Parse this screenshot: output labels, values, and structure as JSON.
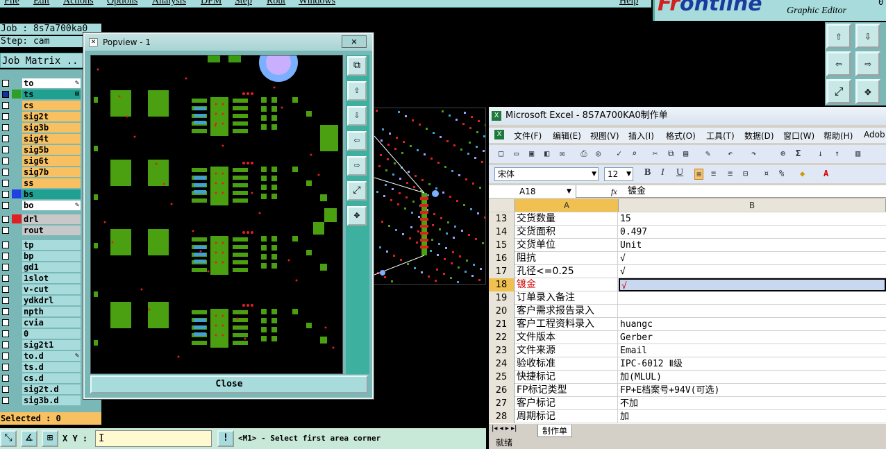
{
  "menu": [
    "File",
    "Edit",
    "Actions",
    "Options",
    "Analysis",
    "DFM",
    "Step",
    "Rout",
    "Windows",
    "Help"
  ],
  "logo": {
    "brand_a": "Fr",
    "brand_b": "ontline",
    "subtitle": "Graphic Editor",
    "version_tail": "0"
  },
  "job": {
    "job_label": "Job : 8s7a700ka0",
    "step_label": "Step: cam",
    "matrix_button": "Job Matrix .."
  },
  "layers": [
    {
      "name": "to",
      "bg": "#ffffff",
      "color": "",
      "icon": "pen"
    },
    {
      "name": "ts",
      "bg": "#20a090",
      "color": "#2aa02a",
      "icon": "grid",
      "checked": true
    },
    {
      "name": "cs",
      "bg": "#f8c060",
      "color": ""
    },
    {
      "name": "sig2t",
      "bg": "#f8c060",
      "color": ""
    },
    {
      "name": "sig3b",
      "bg": "#f8c060",
      "color": ""
    },
    {
      "name": "sig4t",
      "bg": "#f8c060",
      "color": ""
    },
    {
      "name": "sig5b",
      "bg": "#f8c060",
      "color": ""
    },
    {
      "name": "sig6t",
      "bg": "#f8c060",
      "color": ""
    },
    {
      "name": "sig7b",
      "bg": "#f8c060",
      "color": ""
    },
    {
      "name": "ss",
      "bg": "#f8c060",
      "color": ""
    },
    {
      "name": "bs",
      "bg": "#20a090",
      "color": "#2040e0"
    },
    {
      "name": "bo",
      "bg": "#ffffff",
      "color": "",
      "icon": "pen"
    },
    {
      "name": "drl",
      "bg": "#c8c8c8",
      "color": "#e02020"
    },
    {
      "name": "rout",
      "bg": "#c8c8c8",
      "color": ""
    },
    {
      "name": "tp",
      "bg": "#a8dcdc",
      "color": ""
    },
    {
      "name": "bp",
      "bg": "#a8dcdc",
      "color": ""
    },
    {
      "name": "gd1",
      "bg": "#a8dcdc",
      "color": ""
    },
    {
      "name": "1slot",
      "bg": "#a8dcdc",
      "color": ""
    },
    {
      "name": "v-cut",
      "bg": "#a8dcdc",
      "color": ""
    },
    {
      "name": "ydkdrl",
      "bg": "#a8dcdc",
      "color": ""
    },
    {
      "name": "npth",
      "bg": "#a8dcdc",
      "color": ""
    },
    {
      "name": "cvia",
      "bg": "#a8dcdc",
      "color": ""
    },
    {
      "name": "0",
      "bg": "#a8dcdc",
      "color": ""
    },
    {
      "name": "sig2t1",
      "bg": "#a8dcdc",
      "color": ""
    },
    {
      "name": "to.d",
      "bg": "#a8dcdc",
      "color": "",
      "icon": "pen"
    },
    {
      "name": "ts.d",
      "bg": "#a8dcdc",
      "color": ""
    },
    {
      "name": "cs.d",
      "bg": "#a8dcdc",
      "color": ""
    },
    {
      "name": "sig2t.d",
      "bg": "#a8dcdc",
      "color": ""
    },
    {
      "name": "sig3b.d",
      "bg": "#a8dcdc",
      "color": ""
    }
  ],
  "selected_label": "Selected : 0",
  "bottom": {
    "xy_label": "X Y :",
    "status_message": "<M1> - Select first area corner"
  },
  "popview": {
    "title": "Popview - 1",
    "close_x": "✕",
    "close_button": "Close"
  },
  "excel": {
    "title": "Microsoft Excel - 8S7A700KA0制作单",
    "menu": [
      "文件(F)",
      "编辑(E)",
      "视图(V)",
      "插入(I)",
      "格式(O)",
      "工具(T)",
      "数据(D)",
      "窗口(W)",
      "帮助(H)",
      "Adob"
    ],
    "font_name": "宋体",
    "font_size": "12",
    "cell_ref": "A18",
    "formula_value": "镀金",
    "col_a": "A",
    "col_b": "B",
    "rows": [
      {
        "n": "13",
        "a": "交货数量",
        "b": "15"
      },
      {
        "n": "14",
        "a": "交货面积",
        "b": "0.497"
      },
      {
        "n": "15",
        "a": "交货单位",
        "b": "Unit"
      },
      {
        "n": "16",
        "a": "阻抗",
        "b": "√"
      },
      {
        "n": "17",
        "a": "孔径<=0.25",
        "b": "√"
      },
      {
        "n": "18",
        "a": "镀金",
        "b": "√",
        "sel": true
      },
      {
        "n": "19",
        "a": "订单录入备注",
        "b": ""
      },
      {
        "n": "20",
        "a": "客户需求报告录入",
        "b": ""
      },
      {
        "n": "21",
        "a": "客户工程资料录入",
        "b": "huangc"
      },
      {
        "n": "22",
        "a": "文件版本",
        "b": "Gerber"
      },
      {
        "n": "23",
        "a": "文件来源",
        "b": "Email"
      },
      {
        "n": "24",
        "a": "验收标准",
        "b": "IPC-6012 Ⅱ级"
      },
      {
        "n": "25",
        "a": "快捷标记",
        "b": "加(MLUL)"
      },
      {
        "n": "26",
        "a": "FP标记类型",
        "b": "FP+E档案号+94V(可选)"
      },
      {
        "n": "27",
        "a": "客户标记",
        "b": "不加"
      },
      {
        "n": "28",
        "a": "周期标记",
        "b": "加"
      }
    ],
    "sheet_tab": "制作单",
    "status": "就绪"
  }
}
